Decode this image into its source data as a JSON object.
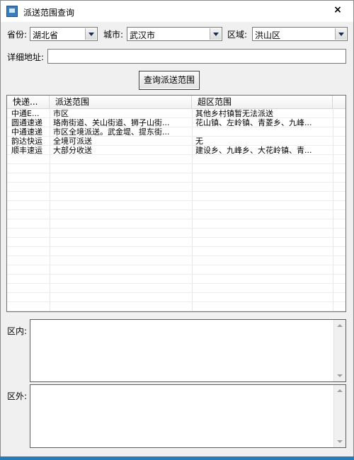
{
  "window": {
    "title": "派送范围查询",
    "close_symbol": "×"
  },
  "filters": {
    "province_label": "省份:",
    "province_value": "湖北省",
    "city_label": "城市:",
    "city_value": "武汉市",
    "district_label": "区域:",
    "district_value": "洪山区",
    "address_label": "详细地址:",
    "address_value": ""
  },
  "query_button": "查询派送范围",
  "table": {
    "columns": [
      "快递...",
      "派送范围",
      "超区范围"
    ],
    "rows": [
      [
        "中通E...",
        "市区",
        "其他乡村镇暂无法派送"
      ],
      [
        "圆通速递",
        "珞南街道、关山街道、狮子山街...",
        "花山镇、左岭镇、青菱乡、九峰..."
      ],
      [
        "中通速递",
        "市区全境派送。武金堤、提东街...",
        ""
      ],
      [
        "韵达快运",
        "全境可派送",
        "无"
      ],
      [
        "顺丰速运",
        "大部分收送",
        "建设乡、九峰乡、大花岭镇、青..."
      ]
    ]
  },
  "inside_area": {
    "label": "区内:",
    "value": ""
  },
  "outside_area": {
    "label": "区外:",
    "value": ""
  }
}
